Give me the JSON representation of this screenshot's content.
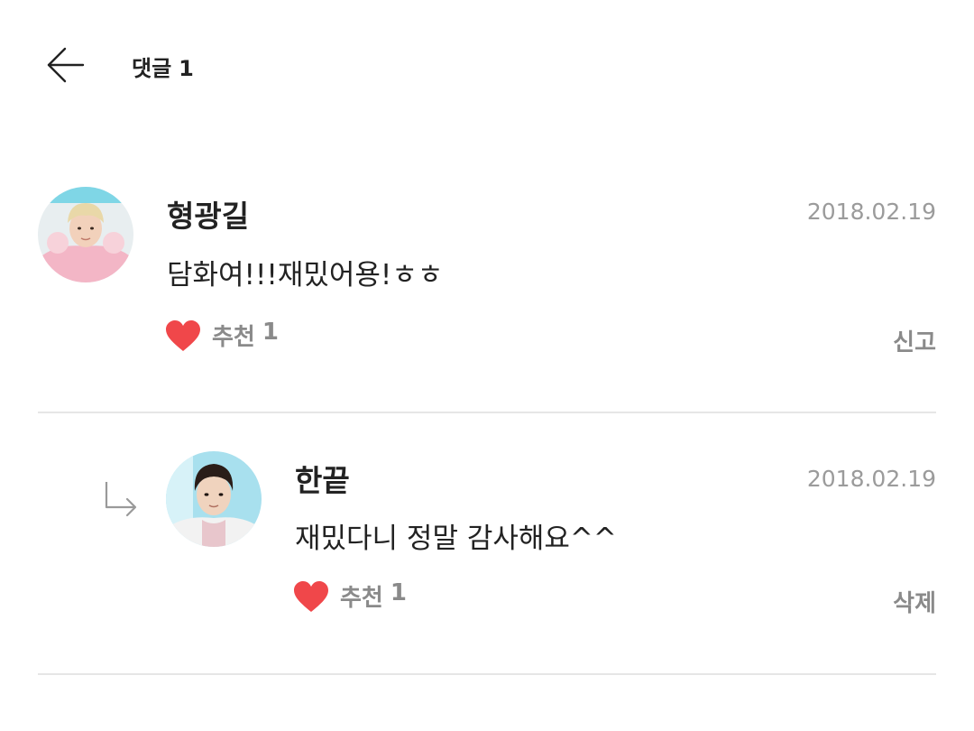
{
  "header": {
    "title": "댓글",
    "count": "1"
  },
  "comments": [
    {
      "author": "형광길",
      "date": "2018.02.19",
      "text": "담화여!!!재밌어용!ㅎㅎ",
      "like_label": "추천",
      "like_count": "1",
      "action": "신고"
    },
    {
      "author": "한끝",
      "date": "2018.02.19",
      "text": "재밌다니 정말 감사해요^^",
      "like_label": "추천",
      "like_count": "1",
      "action": "삭제"
    }
  ],
  "colors": {
    "heart": "#f0474a",
    "muted": "#8a8a8a",
    "date": "#9b9b9b",
    "divider": "#e6e6e6"
  }
}
